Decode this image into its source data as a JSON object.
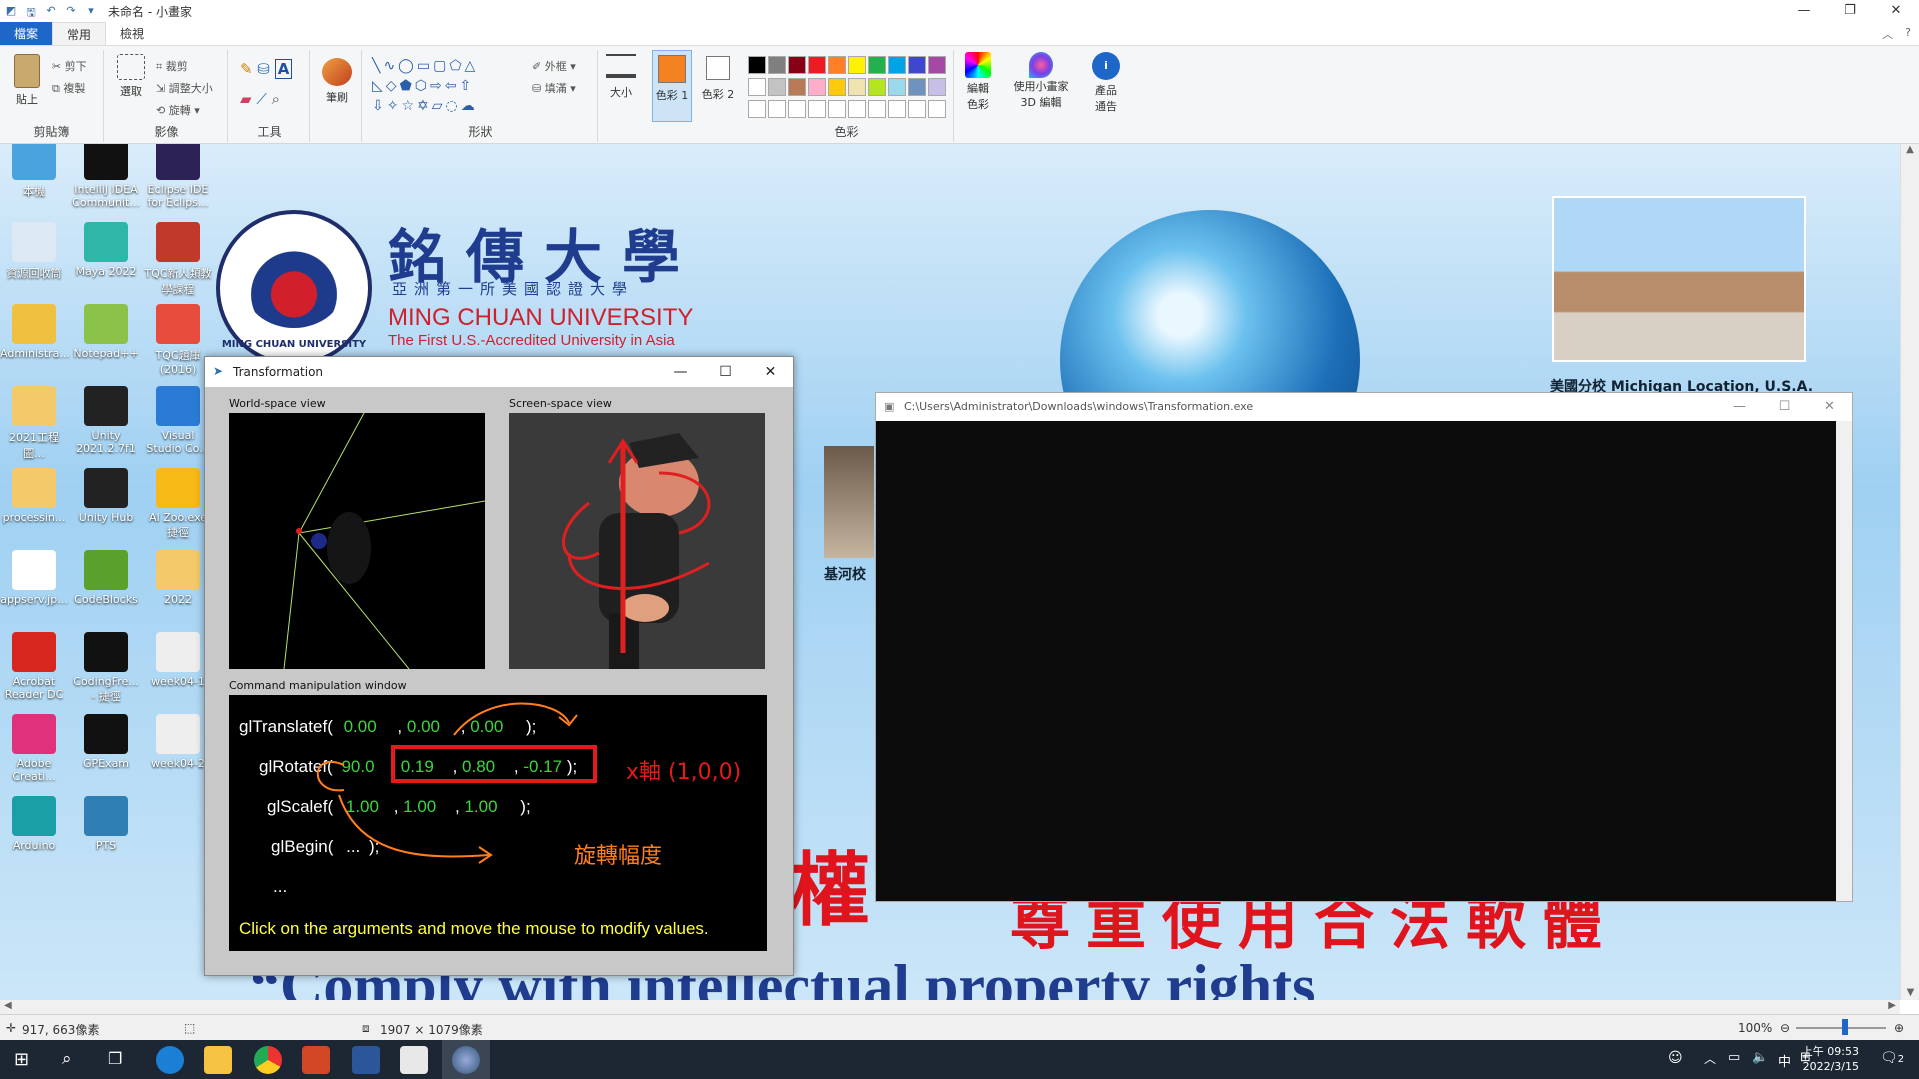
{
  "titlebar": {
    "title": "未命名 - 小畫家",
    "minimize": "—",
    "maximize": "❐",
    "close": "✕"
  },
  "tabs": [
    {
      "label": "檔案"
    },
    {
      "label": "常用"
    },
    {
      "label": "檢視"
    }
  ],
  "ribbon": {
    "clipboard": {
      "paste": "貼上",
      "cut": "剪下",
      "copy": "複製",
      "label": "剪貼簿"
    },
    "image": {
      "select": "選取",
      "crop": "裁剪",
      "resize": "調整大小",
      "rotate": "旋轉",
      "label": "影像"
    },
    "tools": {
      "label": "工具"
    },
    "brushes": {
      "label": "筆刷"
    },
    "shapes": {
      "outline": "外框",
      "fill": "填滿",
      "label": "形狀"
    },
    "size": {
      "label": "大小"
    },
    "color1": {
      "label": "色彩 1",
      "value": "#f58220"
    },
    "color2": {
      "label": "色彩 2",
      "value": "#ffffff"
    },
    "colors": {
      "label": "色彩",
      "row1": [
        "#000000",
        "#7f7f7f",
        "#880015",
        "#ed1c24",
        "#ff7f27",
        "#fff200",
        "#22b14c",
        "#00a2e8",
        "#3f48cc",
        "#a349a4"
      ],
      "row2": [
        "#ffffff",
        "#c3c3c3",
        "#b97a57",
        "#ffaec9",
        "#ffc90e",
        "#efe4b0",
        "#b5e61d",
        "#99d9ea",
        "#7092be",
        "#c8bfe7"
      ]
    },
    "edit_colors": "編輯色彩",
    "paint3d": "使用小畫家 3D 編輯",
    "product_alert": "產品通告"
  },
  "desktop_icons": [
    {
      "label": "本機",
      "color": "#4aa3df"
    },
    {
      "label": "IntelliJ IDEA Communit...",
      "color": "#111111"
    },
    {
      "label": "Eclipse IDE for Eclips...",
      "color": "#2c2255"
    },
    {
      "label": "資源回收筒",
      "color": "#dce9f5"
    },
    {
      "label": "Maya 2022",
      "color": "#2fb6a8"
    },
    {
      "label": "TQC新人類教學課程",
      "color": "#c0392b"
    },
    {
      "label": "Administra...",
      "color": "#f0c040"
    },
    {
      "label": "Notepad++",
      "color": "#8bc34a"
    },
    {
      "label": "TQC題庫(2016)",
      "color": "#e74c3c"
    },
    {
      "label": "2021工程圖...",
      "color": "#f3c969"
    },
    {
      "label": "Unity 2021.2.7f1",
      "color": "#222222"
    },
    {
      "label": "Visual Studio Co...",
      "color": "#2a7bd6"
    },
    {
      "label": "processin...",
      "color": "#f3c969"
    },
    {
      "label": "Unity Hub",
      "color": "#222222"
    },
    {
      "label": "AI Zoo.exe 捷徑",
      "color": "#f6b915"
    },
    {
      "label": "appserv.jp...",
      "color": "#ffffff"
    },
    {
      "label": "CodeBlocks",
      "color": "#5aa02c"
    },
    {
      "label": "2022",
      "color": "#f3c969"
    },
    {
      "label": "Acrobat Reader DC",
      "color": "#d7261e"
    },
    {
      "label": "CodingFre... - 捷徑",
      "color": "#111111"
    },
    {
      "label": "week04-1",
      "color": "#eeeeee"
    },
    {
      "label": "Adobe Creati...",
      "color": "#e0317c"
    },
    {
      "label": "GPExam",
      "color": "#111111"
    },
    {
      "label": "week04-2",
      "color": "#eeeeee"
    },
    {
      "label": "Arduino",
      "color": "#1a9fa6"
    },
    {
      "label": "PTS",
      "color": "#2f7fb5"
    }
  ],
  "banner": {
    "cn_name": "銘傳大學",
    "cn_sub": "亞洲第一所美國認證大學",
    "en_name": "MING CHUAN UNIVERSITY",
    "tagline": "The First U.S.-Accredited University in Asia",
    "logo_text": "MING CHUAN UNIVERSITY",
    "usa_caption": "美國分校 Michigan Location, U.S.A.",
    "keelung": "基河校",
    "red_text_1": "權",
    "red_text_2": "尊重使用合法軟體",
    "comply": "“Comply with intellectual property rights"
  },
  "transformation": {
    "title": "Transformation",
    "world_label": "World-space view",
    "screen_label": "Screen-space view",
    "cmd_label": "Command manipulation window",
    "translate": {
      "fn": "glTranslatef(",
      "a": "0.00",
      "b": "0.00",
      "c": "0.00",
      "end": ");"
    },
    "rotate": {
      "fn": "glRotatef(",
      "angle": "90.0",
      "x": "0.19",
      "y": "0.80",
      "z": "-0.17",
      "end": ");"
    },
    "scale": {
      "fn": "glScalef(",
      "a": "1.00",
      "b": "1.00",
      "c": "1.00",
      "end": ");"
    },
    "begin": {
      "fn": "glBegin(",
      "args": "...",
      "end": ");"
    },
    "dots": "...",
    "hint": "Click on the arguments and move the mouse to modify values.",
    "annotation_axis": "x軸 (1,0,0)",
    "annotation_angle": "旋轉幅度",
    "comma": ","
  },
  "console": {
    "title": "C:\\Users\\Administrator\\Downloads\\windows\\Transformation.exe"
  },
  "status": {
    "cursor": "917, 663像素",
    "size": "1907 × 1079像素",
    "zoom": "100%"
  },
  "taskbar": {
    "time": "上午 09:53",
    "date": "2022/3/15",
    "ime": "中",
    "notifications": "2"
  }
}
